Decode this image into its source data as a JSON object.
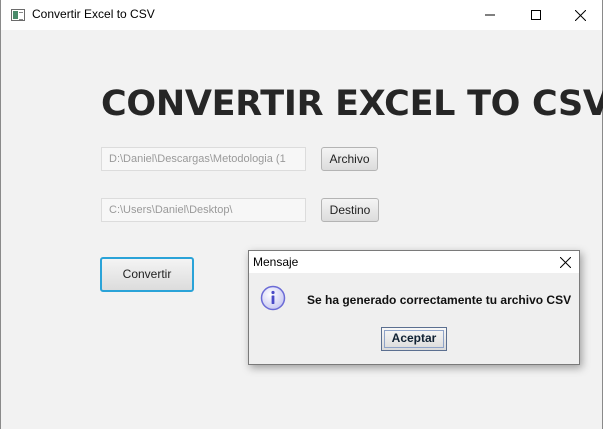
{
  "window": {
    "title": "Convertir Excel to CSV",
    "icon": "app-window-icon",
    "controls": [
      "minimize-icon",
      "maximize-icon",
      "close-icon"
    ]
  },
  "main": {
    "heading": "CONVERTIR EXCEL TO CSV",
    "source_path": "D:\\Daniel\\Descargas\\Metodologia (1",
    "source_button": "Archivo",
    "dest_path": "C:\\Users\\Daniel\\Desktop\\",
    "dest_button": "Destino",
    "convert_button": "Convertir"
  },
  "dialog": {
    "title": "Mensaje",
    "icon": "info-icon",
    "message": "Se ha generado correctamente tu archivo CSV",
    "ok_button": "Aceptar"
  },
  "colors": {
    "focus_border": "#2aa3d8",
    "heading": "#262626",
    "info_icon": "#6b6bd6"
  }
}
